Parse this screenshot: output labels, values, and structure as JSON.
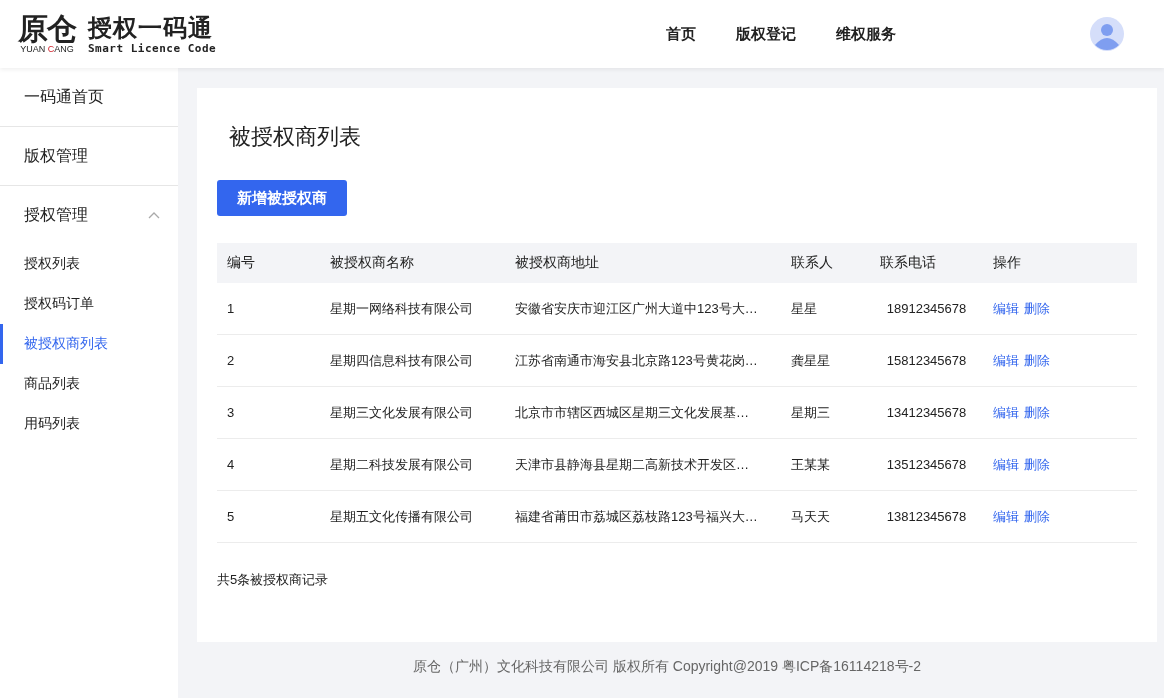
{
  "logo": {
    "mark": "原仓",
    "sub": [
      {
        "text": "YUAN ",
        "accent": false
      },
      {
        "text": "C",
        "accent": true
      },
      {
        "text": "ANG",
        "accent": false
      }
    ],
    "title": "授权一码通",
    "subtitle": "Smart Licence Code"
  },
  "nav": [
    {
      "label": "首页"
    },
    {
      "label": "版权登记"
    },
    {
      "label": "维权服务"
    }
  ],
  "sidebar": {
    "items": [
      {
        "kind": "section",
        "label": "一码通首页"
      },
      {
        "kind": "section",
        "label": "版权管理"
      },
      {
        "kind": "group",
        "label": "授权管理",
        "expanded": true,
        "children": [
          {
            "label": "授权列表",
            "selected": false
          },
          {
            "label": "授权码订单",
            "selected": false
          },
          {
            "label": "被授权商列表",
            "selected": true
          },
          {
            "label": "商品列表",
            "selected": false
          },
          {
            "label": "用码列表",
            "selected": false
          }
        ]
      }
    ]
  },
  "page_title": "被授权商列表",
  "add_button": "新增被授权商",
  "table": {
    "columns": [
      "编号",
      "被授权商名称",
      "被授权商地址",
      "联系人",
      "联系电话",
      "操作"
    ],
    "rows": [
      {
        "id": "1",
        "name": "星期一网络科技有限公司",
        "address": "安徽省安庆市迎江区广州大道中123号大…",
        "contact": "星星",
        "phone": "18912345678",
        "actions": [
          "编辑",
          "删除"
        ]
      },
      {
        "id": "2",
        "name": "星期四信息科技有限公司",
        "address": "江苏省南通市海安县北京路123号黄花岗…",
        "contact": "龚星星",
        "phone": "15812345678",
        "actions": [
          "编辑",
          "删除"
        ]
      },
      {
        "id": "3",
        "name": "星期三文化发展有限公司",
        "address": "北京市市辖区西城区星期三文化发展基…",
        "contact": "星期三",
        "phone": "13412345678",
        "actions": [
          "编辑",
          "删除"
        ]
      },
      {
        "id": "4",
        "name": "星期二科技发展有限公司",
        "address": "天津市县静海县星期二高新技术开发区…",
        "contact": "王某某",
        "phone": "13512345678",
        "actions": [
          "编辑",
          "删除"
        ]
      },
      {
        "id": "5",
        "name": "星期五文化传播有限公司",
        "address": "福建省莆田市荔城区荔枝路123号福兴大…",
        "contact": "马天天",
        "phone": "13812345678",
        "actions": [
          "编辑",
          "删除"
        ]
      }
    ]
  },
  "total": "共5条被授权商记录",
  "footer": "原仓（广州）文化科技有限公司 版权所有 Copyright@2019 粤ICP备16114218号-2"
}
